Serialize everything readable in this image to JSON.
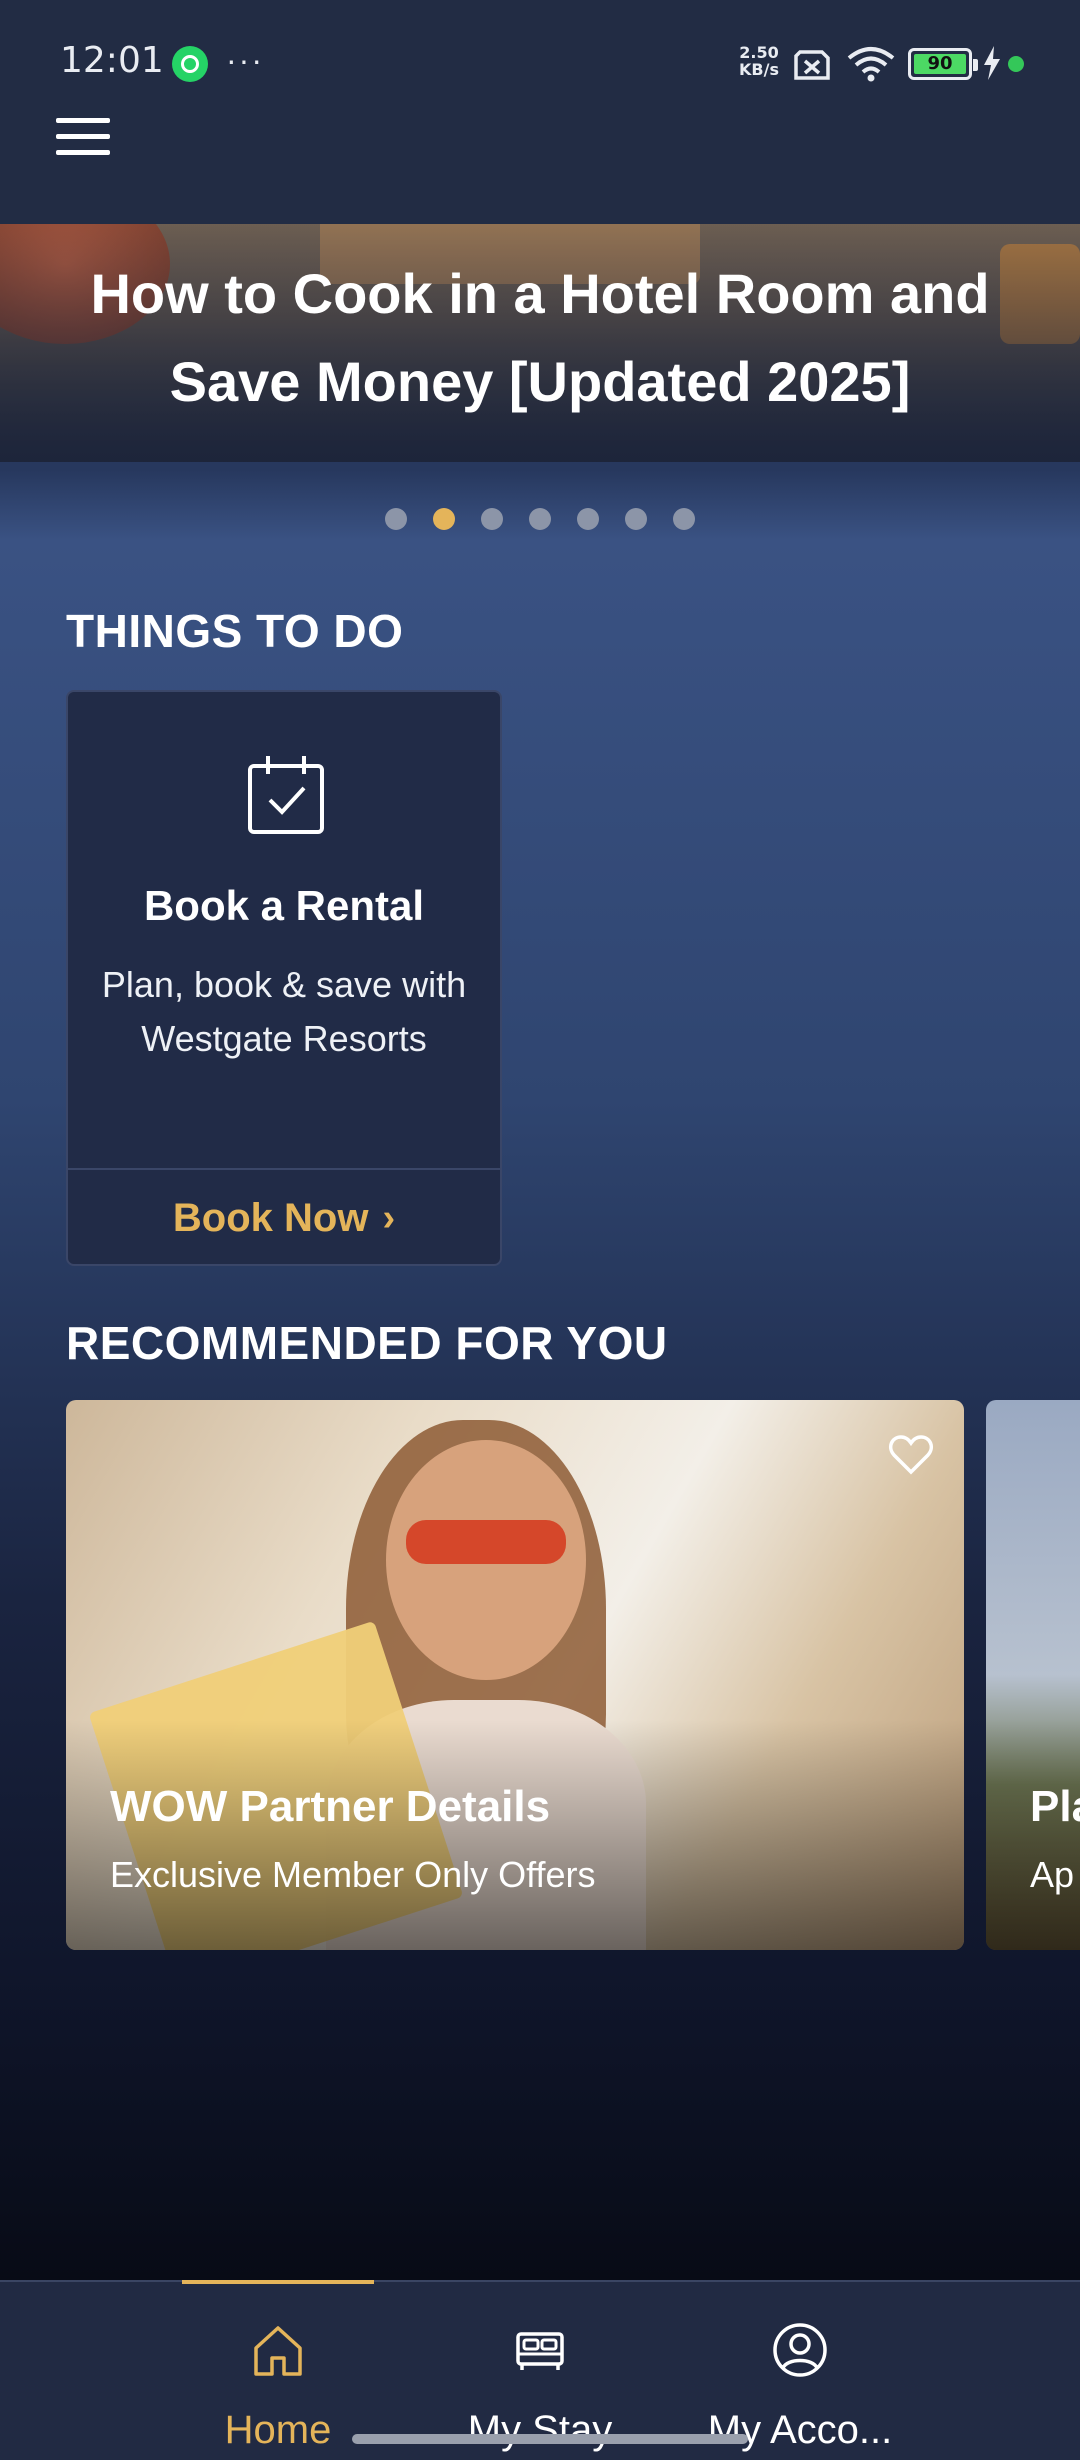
{
  "status_bar": {
    "time": "12:01",
    "more_dots": "···",
    "net_speed_value": "2.50",
    "net_speed_unit": "KB/s",
    "battery_level": "90"
  },
  "header": {
    "menu_icon": "hamburger-menu-icon"
  },
  "banner": {
    "title": "How to Cook in a Hotel Room and Save Money [Updated 2025]",
    "slide_count": 7,
    "active_slide": 2
  },
  "things_to_do": {
    "section_title": "THINGS TO DO",
    "card": {
      "icon": "calendar-check-icon",
      "title": "Book a Rental",
      "description": "Plan, book & save with Westgate Resorts",
      "cta": "Book Now",
      "cta_chevron": "›"
    }
  },
  "recommended": {
    "section_title": "RECOMMENDED FOR YOU",
    "items": [
      {
        "title": "WOW Partner Details",
        "subtitle": "Exclusive Member Only Offers",
        "icon": "heart-outline-icon"
      },
      {
        "title": "Pla",
        "subtitle": "Ap"
      }
    ]
  },
  "bottom_nav": {
    "items": [
      {
        "label": "Home",
        "icon": "home-icon",
        "active": true
      },
      {
        "label": "My Stay",
        "icon": "bed-icon",
        "active": false
      },
      {
        "label": "My Acco...",
        "icon": "account-circle-icon",
        "active": false
      }
    ]
  },
  "colors": {
    "accent": "#e4b45a",
    "header_bg": "#222c44",
    "card_bg": "#212b47",
    "nav_bg": "#212a43",
    "inactive_dot": "#8c95a8"
  }
}
